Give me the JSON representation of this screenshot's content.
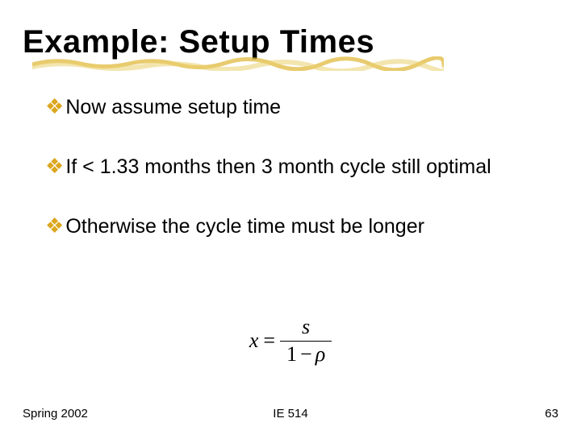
{
  "title": "Example: Setup Times",
  "bullets": [
    "Now assume setup time",
    "If < 1.33 months then 3 month cycle still optimal",
    "Otherwise the cycle time must be longer"
  ],
  "formula": {
    "lhs": "x",
    "eq": "=",
    "numerator": "s",
    "denom_left": "1",
    "denom_minus": "−",
    "denom_right": "ρ"
  },
  "footer": {
    "left": "Spring 2002",
    "center": "IE 514",
    "right": "63"
  }
}
